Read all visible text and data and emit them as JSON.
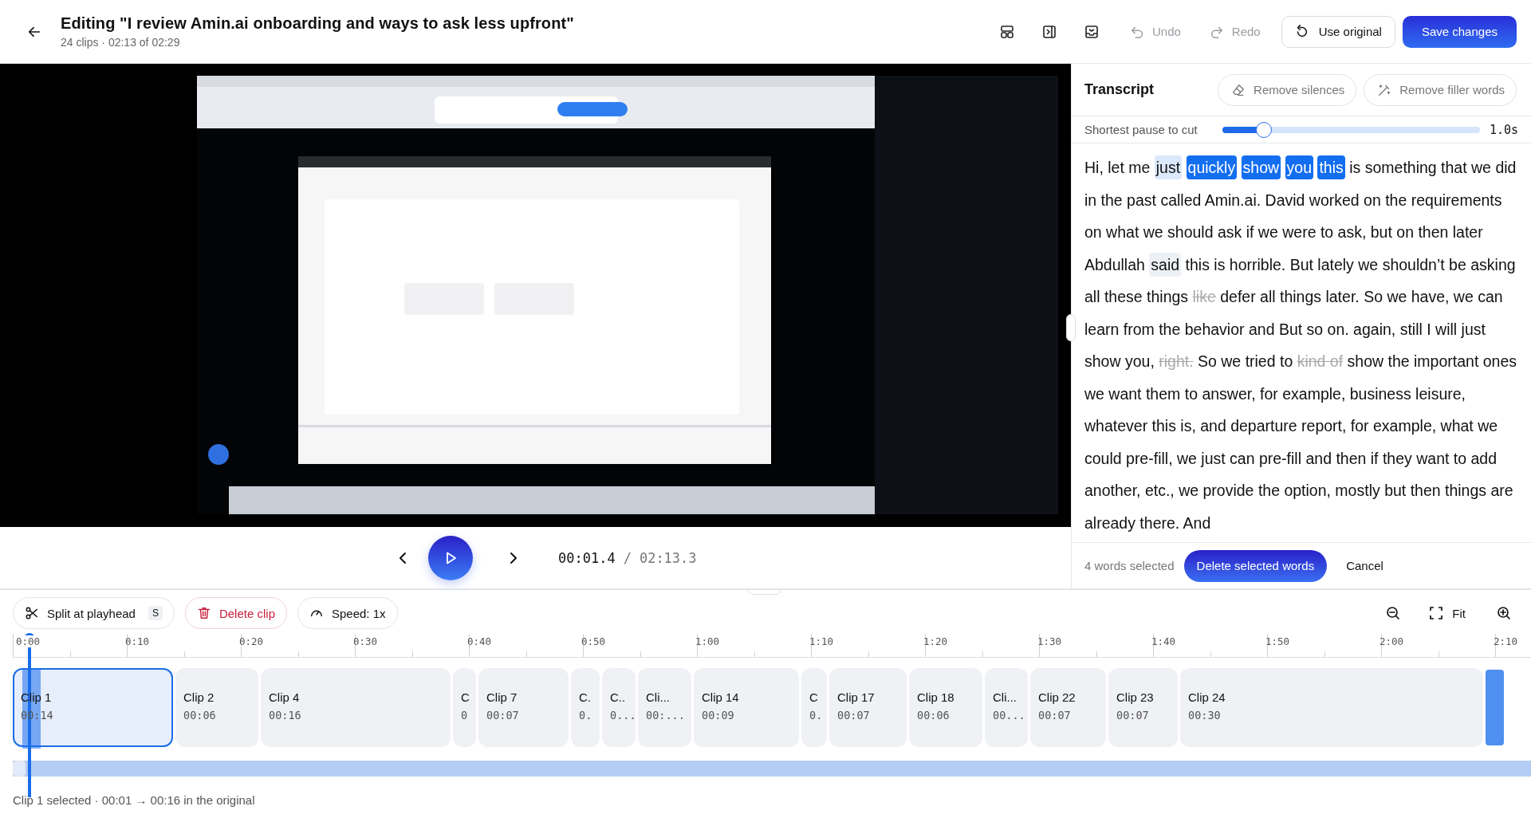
{
  "header": {
    "title": "Editing \"I review Amin.ai onboarding and ways to ask less upfront\"",
    "subtitle": "24 clips · 02:13 of 02:29"
  },
  "toolbar": {
    "history": [
      {
        "kind": "undo",
        "label": "Undo",
        "disabled": true
      },
      {
        "kind": "redo",
        "label": "Redo",
        "disabled": true
      }
    ],
    "use_original": "Use original",
    "save": "Save changes"
  },
  "player": {
    "current_time": "00:01.4",
    "separator": "/",
    "duration": "02:13.3"
  },
  "transcript": {
    "title": "Transcript",
    "actions": [
      {
        "kind": "silences",
        "label": "Remove silences"
      },
      {
        "kind": "filler",
        "label": "Remove filler words"
      }
    ],
    "pause": {
      "label": "Shortest pause to cut",
      "level": 0.16,
      "reading": "1.0s"
    },
    "segments": [
      {
        "text": "Hi, let me",
        "kind": "plain"
      },
      {
        "text": "just",
        "kind": "hover"
      },
      {
        "text": "quickly",
        "kind": "selected"
      },
      {
        "text": "show",
        "kind": "selected"
      },
      {
        "text": "you",
        "kind": "selected"
      },
      {
        "text": "this",
        "kind": "selected"
      },
      {
        "text": "is something that we did in the past called Amin.ai. David worked on the requirements on what we should ask if we were to ask, but on then later Abdullah",
        "kind": "plain"
      },
      {
        "text": "said",
        "kind": "marked"
      },
      {
        "text": "this is horrible. But lately we shouldn’t be asking all these things",
        "kind": "plain"
      },
      {
        "text": "like",
        "kind": "removed"
      },
      {
        "text": "defer all things later. So we have, we can learn from the behavior and But so on. again, still I will just show you,",
        "kind": "plain"
      },
      {
        "text": "right.",
        "kind": "removed"
      },
      {
        "text": "So we tried to",
        "kind": "plain"
      },
      {
        "text": "kind of",
        "kind": "removed"
      },
      {
        "text": "show the important ones we want them to answer, for example, business leisure, whatever this is, and departure report, for example, what we could pre-fill, we just can pre-fill and then if they want to add another, etc., we provide the option, mostly but then things are already there. And",
        "kind": "plain"
      }
    ],
    "selection": {
      "count": "4 words selected",
      "delete": "Delete selected words",
      "cancel": "Cancel"
    }
  },
  "timeline": {
    "actions": [
      {
        "kind": "split",
        "label": "Split at playhead",
        "shortcut": "S"
      },
      {
        "kind": "delete",
        "label": "Delete clip"
      },
      {
        "kind": "speed",
        "label": "Speed: 1x"
      }
    ],
    "fit": "Fit",
    "ruler": [
      "0:00",
      "0:10",
      "0:20",
      "0:30",
      "0:40",
      "0:50",
      "1:00",
      "1:10",
      "1:20",
      "1:30",
      "1:40",
      "1:50",
      "2:00",
      "2:10"
    ],
    "clips": [
      {
        "label": "Clip 1",
        "duration": "00:14",
        "selected": true
      },
      {
        "label": "Clip 2",
        "duration": "00:06",
        "selected": false
      },
      {
        "label": "Clip 4",
        "duration": "00:16",
        "selected": false
      },
      {
        "label": "C",
        "duration": "0",
        "selected": false
      },
      {
        "label": "Clip 7",
        "duration": "00:07",
        "selected": false
      },
      {
        "label": "C.",
        "duration": "0.",
        "selected": false
      },
      {
        "label": "C..",
        "duration": "0...",
        "selected": false
      },
      {
        "label": "Cli...",
        "duration": "00:...",
        "selected": false
      },
      {
        "label": "Clip 14",
        "duration": "00:09",
        "selected": false
      },
      {
        "label": "C",
        "duration": "0.",
        "selected": false
      },
      {
        "label": "Clip 17",
        "duration": "00:07",
        "selected": false
      },
      {
        "label": "Clip 18",
        "duration": "00:06",
        "selected": false
      },
      {
        "label": "Cli...",
        "duration": "00...",
        "selected": false
      },
      {
        "label": "Clip 22",
        "duration": "00:07",
        "selected": false
      },
      {
        "label": "Clip 23",
        "duration": "00:07",
        "selected": false
      },
      {
        "label": "Clip 24",
        "duration": "00:30",
        "selected": false
      }
    ],
    "status": "Clip 1 selected · 00:01 → 00:16 in the original"
  }
}
